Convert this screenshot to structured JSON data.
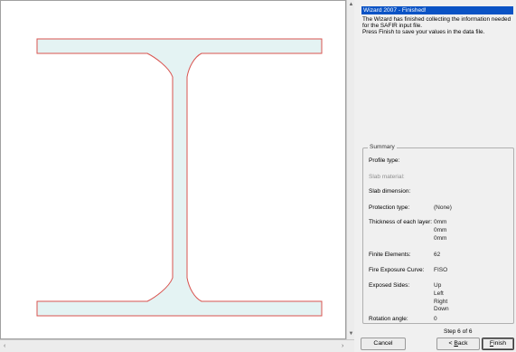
{
  "wizard": {
    "title": "Wizard 2007 - Finished!",
    "message": "The Wizard has finished collecting the information needed for the SAFIR input file.\nPress Finish to save your values in the data file.",
    "summary": {
      "legend": "Summary",
      "rows": [
        {
          "label": "Profile type:",
          "values": [],
          "disabled": false
        },
        {
          "label": "Slab material:",
          "values": [],
          "disabled": true
        },
        {
          "label": "Slab dimension:",
          "values": [],
          "disabled": false
        },
        {
          "label": "Protection type:",
          "values": [
            "(None)"
          ],
          "disabled": false
        },
        {
          "label": "Thickness of each layer:",
          "values": [
            "0mm",
            "0mm",
            "0mm"
          ],
          "disabled": false
        },
        {
          "label": "Finite Elements:",
          "values": [
            "62"
          ],
          "disabled": false
        },
        {
          "label": "Fire Exposure Curve:",
          "values": [
            "FISO"
          ],
          "disabled": false
        },
        {
          "label": "Exposed Sides:",
          "values": [
            "Up",
            "Left",
            "Right",
            "Down"
          ],
          "disabled": false
        },
        {
          "label": "Rotation angle:",
          "values": [
            "0"
          ],
          "disabled": false
        }
      ]
    },
    "step_text": "Step 6 of 6",
    "buttons": {
      "cancel": "Cancel",
      "back_prefix": "< ",
      "back_mnemonic": "B",
      "back_rest": "ack",
      "finish_mnemonic": "F",
      "finish_rest": "inish"
    }
  },
  "profile": {
    "fill_color": "#e4f3f3",
    "outline_color": "#d9534f"
  }
}
